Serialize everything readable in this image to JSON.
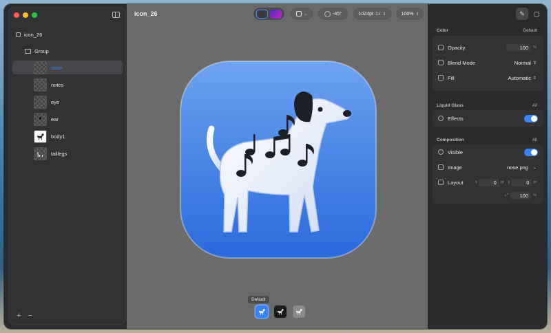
{
  "window": {
    "title": "icon_26"
  },
  "sidebar": {
    "root": "icon_26",
    "group": "Group",
    "layers": [
      {
        "label": "nose",
        "thumb": "checker",
        "selected": true
      },
      {
        "label": "notes",
        "thumb": "checker",
        "selected": false
      },
      {
        "label": "eye",
        "thumb": "checker",
        "selected": false
      },
      {
        "label": "ear",
        "thumb": "checker",
        "selected": false
      },
      {
        "label": "body1",
        "thumb": "dog-white",
        "selected": false
      },
      {
        "label": "taillegs",
        "thumb": "checker",
        "selected": false
      }
    ],
    "footer": {
      "add": "+",
      "remove": "−"
    }
  },
  "toolbar": {
    "angle": "-45°",
    "size": "1024pt",
    "scale": "1x",
    "zoom": "100%"
  },
  "canvas": {
    "variant_label": "Default",
    "variants": [
      "default",
      "dark",
      "mono"
    ]
  },
  "inspector": {
    "color": {
      "title": "Color",
      "menu": "Default",
      "opacity_label": "Opacity",
      "opacity_value": "100",
      "opacity_unit": "%",
      "blend_label": "Blend Mode",
      "blend_value": "Normal",
      "fill_label": "Fill",
      "fill_value": "Automatic"
    },
    "liquid_glass": {
      "title": "Liquid Glass",
      "menu": "All",
      "effects_label": "Effects",
      "effects_on": true
    },
    "composition": {
      "title": "Composition",
      "menu": "All",
      "visible_label": "Visible",
      "visible_on": true,
      "image_label": "Image",
      "image_value": "nose.png",
      "layout_label": "Layout",
      "x_label": "x",
      "x_value": "0",
      "y_label": "y",
      "y_value": "0",
      "unit_pt": "pt",
      "scale_value": "100",
      "scale_unit": "%"
    }
  },
  "colors": {
    "accent": "#3b82f6",
    "icon_bg_top": "#5b93ec",
    "icon_bg_bottom": "#2e6fe0"
  }
}
